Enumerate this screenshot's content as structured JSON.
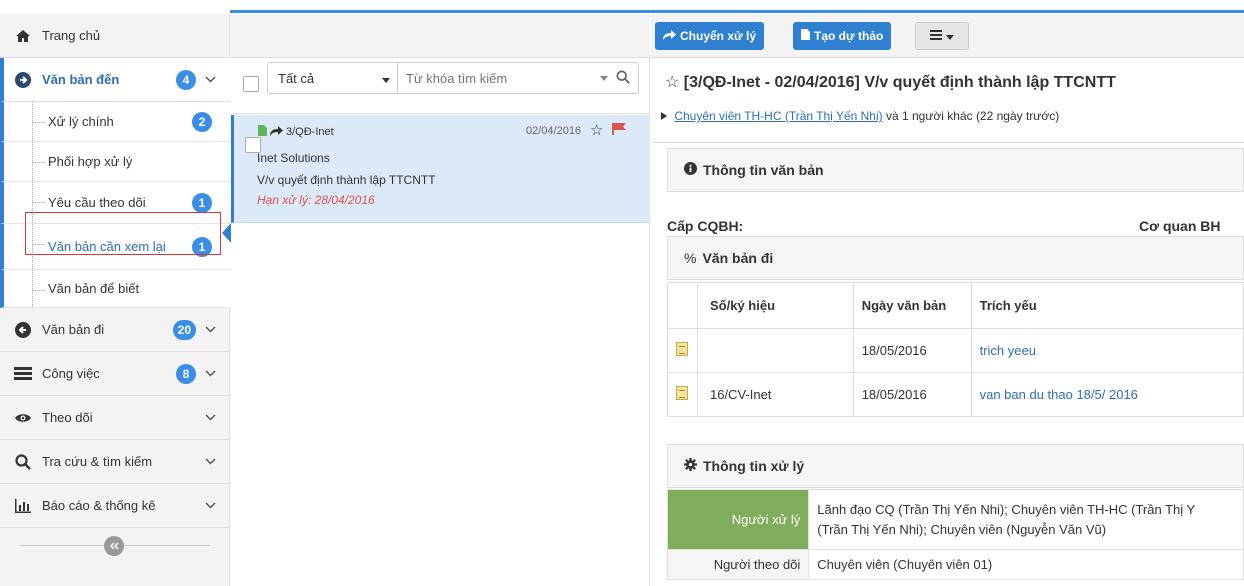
{
  "sidebar": {
    "home": "Trang chủ",
    "incoming": {
      "label": "Văn bản đến",
      "badge": "4"
    },
    "sub": [
      {
        "label": "Xử lý chính",
        "badge": "2"
      },
      {
        "label": "Phối hợp xử lý",
        "badge": ""
      },
      {
        "label": "Yêu cầu theo dõi",
        "badge": "1"
      },
      {
        "label": "Văn bản cần xem lại",
        "badge": "1"
      },
      {
        "label": "Văn bản để biết",
        "badge": ""
      }
    ],
    "outgoing": {
      "label": "Văn bản đi",
      "badge": "20"
    },
    "tasks": {
      "label": "Công việc",
      "badge": "8"
    },
    "follow": "Theo dõi",
    "search": "Tra cứu & tìm kiếm",
    "report": "Báo cáo & thống kê"
  },
  "list": {
    "filter_selected": "Tất cả",
    "search_placeholder": "Từ khóa tìm kiếm",
    "item": {
      "code": "3/QĐ-Inet",
      "date": "02/04/2016",
      "org": "Inet Solutions",
      "summary": "V/v quyết định thành lập TTCNTT",
      "deadline": "Hạn xử lý: 28/04/2016"
    }
  },
  "detail": {
    "toolbar": {
      "forward": "Chuyển xử lý",
      "draft": "Tạo dự thảo"
    },
    "title": "[3/QĐ-Inet - 02/04/2016] V/v quyết định thành lập TTCNTT",
    "sender_link": "Chuyên viên TH-HC (Trần Thị Yến Nhi)",
    "sender_rest": " và 1 người khác (22 ngày trước)",
    "info_head": "Thông tin văn bản",
    "cap_label": "Cấp CQBH:",
    "coquan_label": "Cơ quan BH",
    "outgoing_head": "Văn bản đi",
    "table": {
      "headers": [
        "Số/ký hiệu",
        "Ngày văn bản",
        "Trích yếu"
      ],
      "rows": [
        {
          "so": "",
          "ngay": "18/05/2016",
          "trich": "trich yeeu"
        },
        {
          "so": "16/CV-Inet",
          "ngay": "18/05/2016",
          "trich": "van ban du thao 18/5/ 2016"
        }
      ]
    },
    "process_head": "Thông tin xử lý",
    "process": {
      "handler_label": "Người xử lý",
      "handler_line1": "Lãnh đạo CQ (Trần Thị Yến Nhi); Chuyên viên TH-HC (Trần Thị Y",
      "handler_line2": "(Trần Thị Yến Nhi); Chuyên viên (Nguyễn Văn Vũ)",
      "follower_label": "Người theo dõi",
      "follower_value": "Chuyên viên (Chuyên viên 01)"
    }
  },
  "colors": {
    "accent": "#2f80d1",
    "green": "#7fad5b",
    "red": "#d9534f"
  }
}
